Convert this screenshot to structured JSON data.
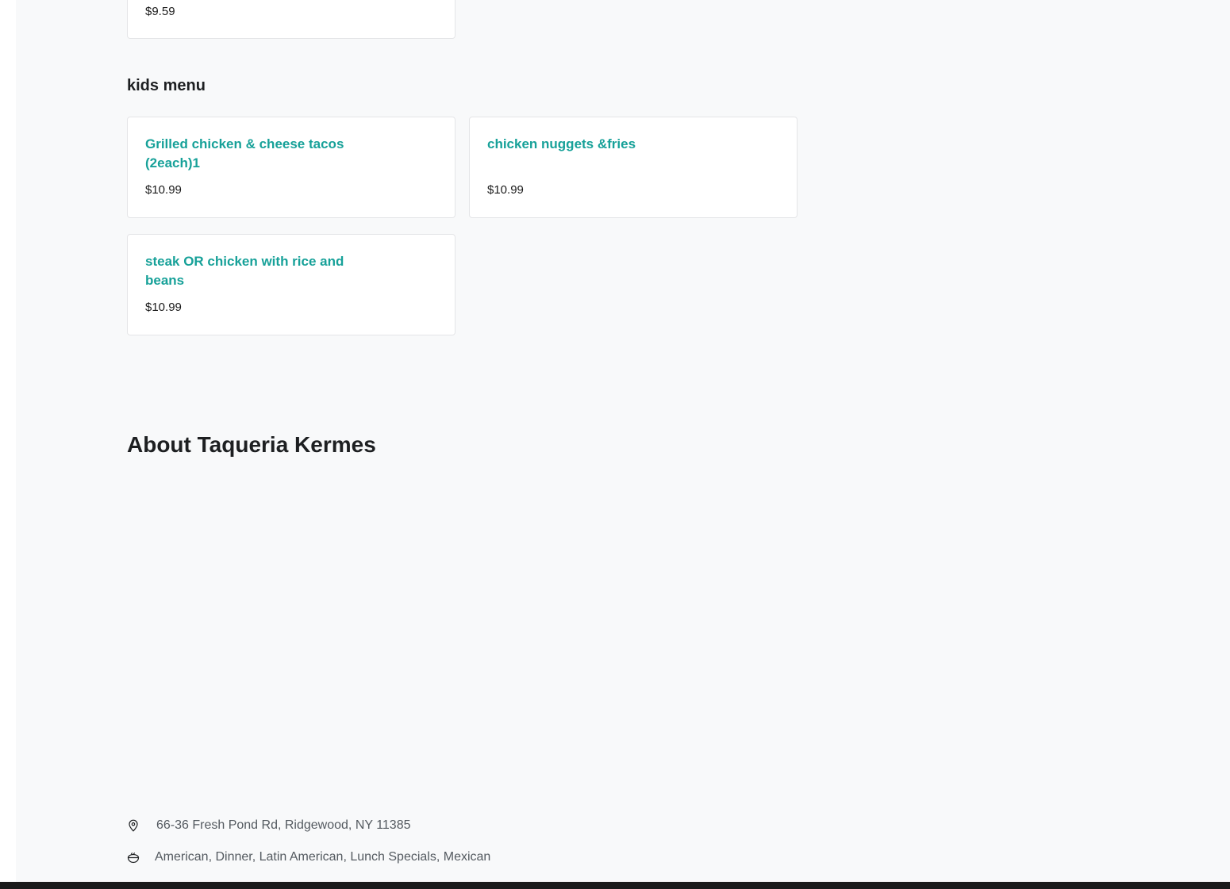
{
  "previous_section": {
    "last_item_price": "$9.59"
  },
  "kids_menu": {
    "heading": "kids menu",
    "items": [
      {
        "name": "Grilled chicken & cheese tacos (2each)1",
        "price": "$10.99"
      },
      {
        "name": "chicken nuggets &fries",
        "price": "$10.99"
      },
      {
        "name": "steak OR chicken with rice and beans",
        "price": "$10.99"
      }
    ]
  },
  "about": {
    "title": "About Taqueria Kermes",
    "address": "66-36 Fresh Pond Rd, Ridgewood, NY 11385",
    "cuisines": "American, Dinner, Latin American, Lunch Specials, Mexican"
  },
  "icons": {
    "address": "map-pin-icon",
    "cuisines": "food-bowl-icon"
  },
  "colors": {
    "item_title": "#17a199",
    "background": "#f8f9fa",
    "card": "#ffffff"
  }
}
